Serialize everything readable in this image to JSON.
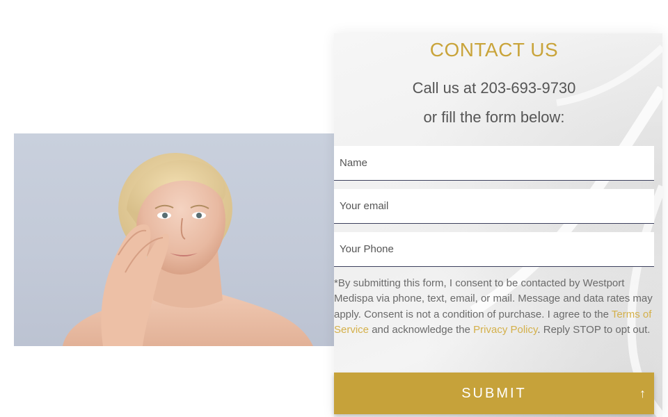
{
  "contact": {
    "title": "CONTACT US",
    "call_line": "Call us at 203-693-9730",
    "form_line": "or fill the form below:"
  },
  "form": {
    "name_placeholder": "Name",
    "email_placeholder": "Your email",
    "phone_placeholder": "Your Phone",
    "consent_part1": "*By submitting this form, I consent to be contacted by Westport Medispa via phone, text, email, or mail. Message and data rates may apply. Consent is not a condition of purchase. I agree to the ",
    "terms_link": "Terms of Service",
    "consent_part2": " and acknowledge the ",
    "privacy_link": "Privacy Policy",
    "consent_part3": ". Reply STOP to opt out.",
    "submit_label": "SUBMIT",
    "submit_icon": "arrow-up-icon"
  },
  "colors": {
    "accent_gold": "#c6a23a",
    "link_gold": "#d4b04a",
    "title_gold": "#c9a43a",
    "text_gray": "#555555"
  },
  "image": {
    "alt": "woman touching her face skincare"
  }
}
